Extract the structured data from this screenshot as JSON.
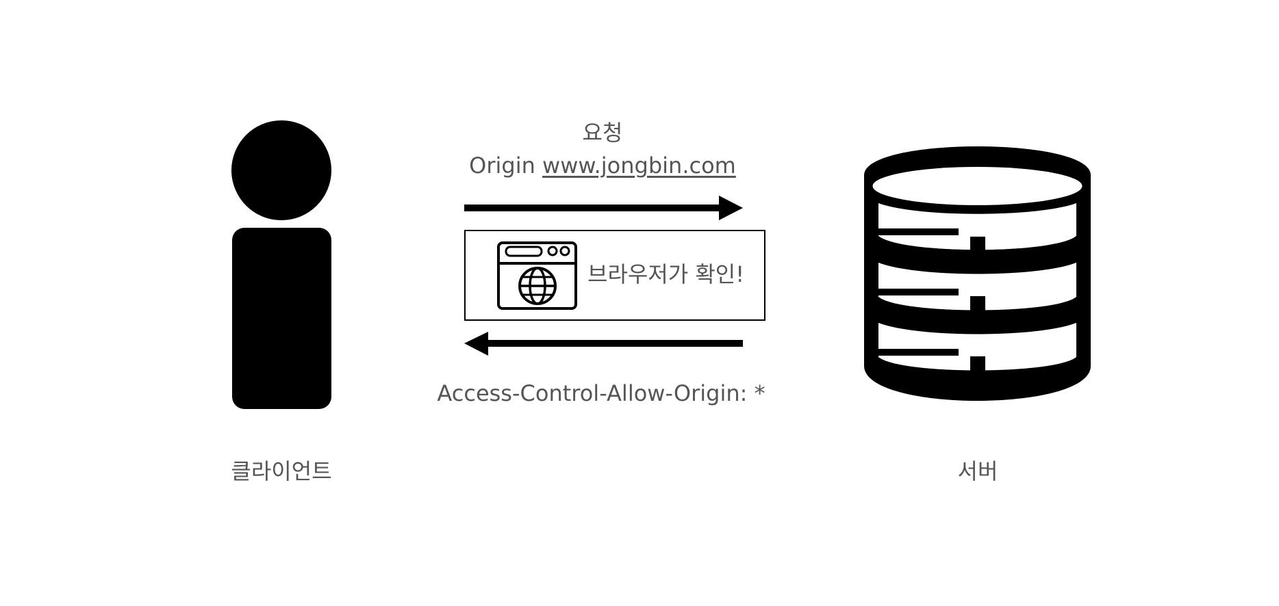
{
  "client": {
    "label": "클라이언트",
    "icon": "person-icon"
  },
  "server": {
    "label": "서버",
    "icon": "database-server-icon"
  },
  "request": {
    "title": "요청",
    "origin_prefix": "Origin",
    "origin_url": "www.jongbin.com",
    "arrow_icon": "arrow-right-icon"
  },
  "browser_check": {
    "label": "브라우저가 확인!",
    "icon": "browser-globe-icon"
  },
  "response": {
    "header": "Access-Control-Allow-Origin: *",
    "arrow_icon": "arrow-left-icon"
  },
  "colors": {
    "text": "#555555",
    "icon": "#000000",
    "background": "#ffffff"
  }
}
